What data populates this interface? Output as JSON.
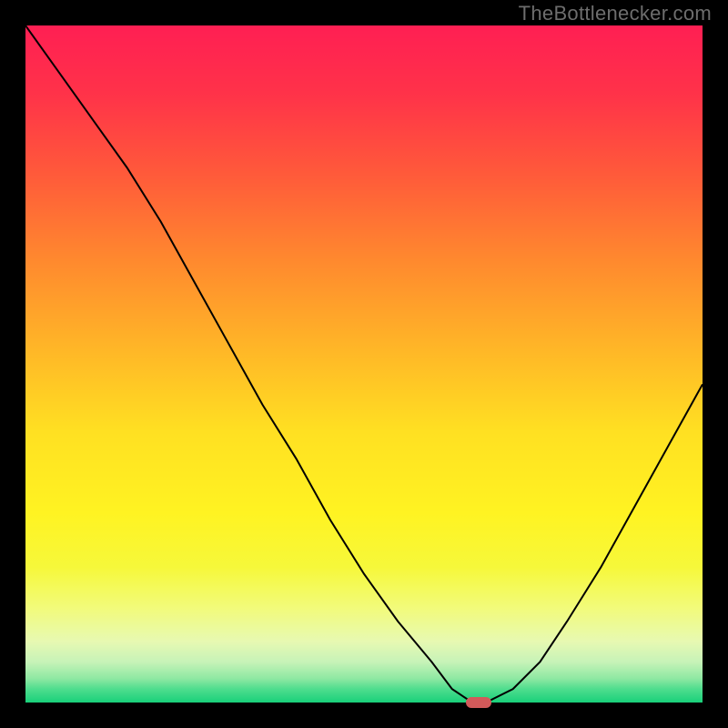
{
  "watermark": "TheBottlenecker.com",
  "chart_data": {
    "type": "line",
    "title": "",
    "xlabel": "",
    "ylabel": "",
    "xlim": [
      0,
      100
    ],
    "ylim": [
      0,
      100
    ],
    "x": [
      0,
      5,
      10,
      15,
      20,
      25,
      30,
      35,
      40,
      45,
      50,
      55,
      60,
      63,
      66,
      68,
      72,
      76,
      80,
      85,
      90,
      95,
      100
    ],
    "values": [
      100,
      93,
      86,
      79,
      71,
      62,
      53,
      44,
      36,
      27,
      19,
      12,
      6,
      2,
      0,
      0,
      2,
      6,
      12,
      20,
      29,
      38,
      47
    ],
    "marker": {
      "x": 67,
      "y": 0
    },
    "gradient_stops": [
      {
        "pct": 0,
        "color": "#ff1f53"
      },
      {
        "pct": 10,
        "color": "#ff3249"
      },
      {
        "pct": 22,
        "color": "#ff5a3a"
      },
      {
        "pct": 35,
        "color": "#ff8a2e"
      },
      {
        "pct": 48,
        "color": "#ffb727"
      },
      {
        "pct": 60,
        "color": "#ffe022"
      },
      {
        "pct": 72,
        "color": "#fff322"
      },
      {
        "pct": 80,
        "color": "#f6f83a"
      },
      {
        "pct": 86,
        "color": "#f2fb7a"
      },
      {
        "pct": 91,
        "color": "#e7f9b2"
      },
      {
        "pct": 94,
        "color": "#c7f3b8"
      },
      {
        "pct": 96.5,
        "color": "#8de8a2"
      },
      {
        "pct": 98,
        "color": "#4fdd8e"
      },
      {
        "pct": 100,
        "color": "#19d07a"
      }
    ]
  }
}
